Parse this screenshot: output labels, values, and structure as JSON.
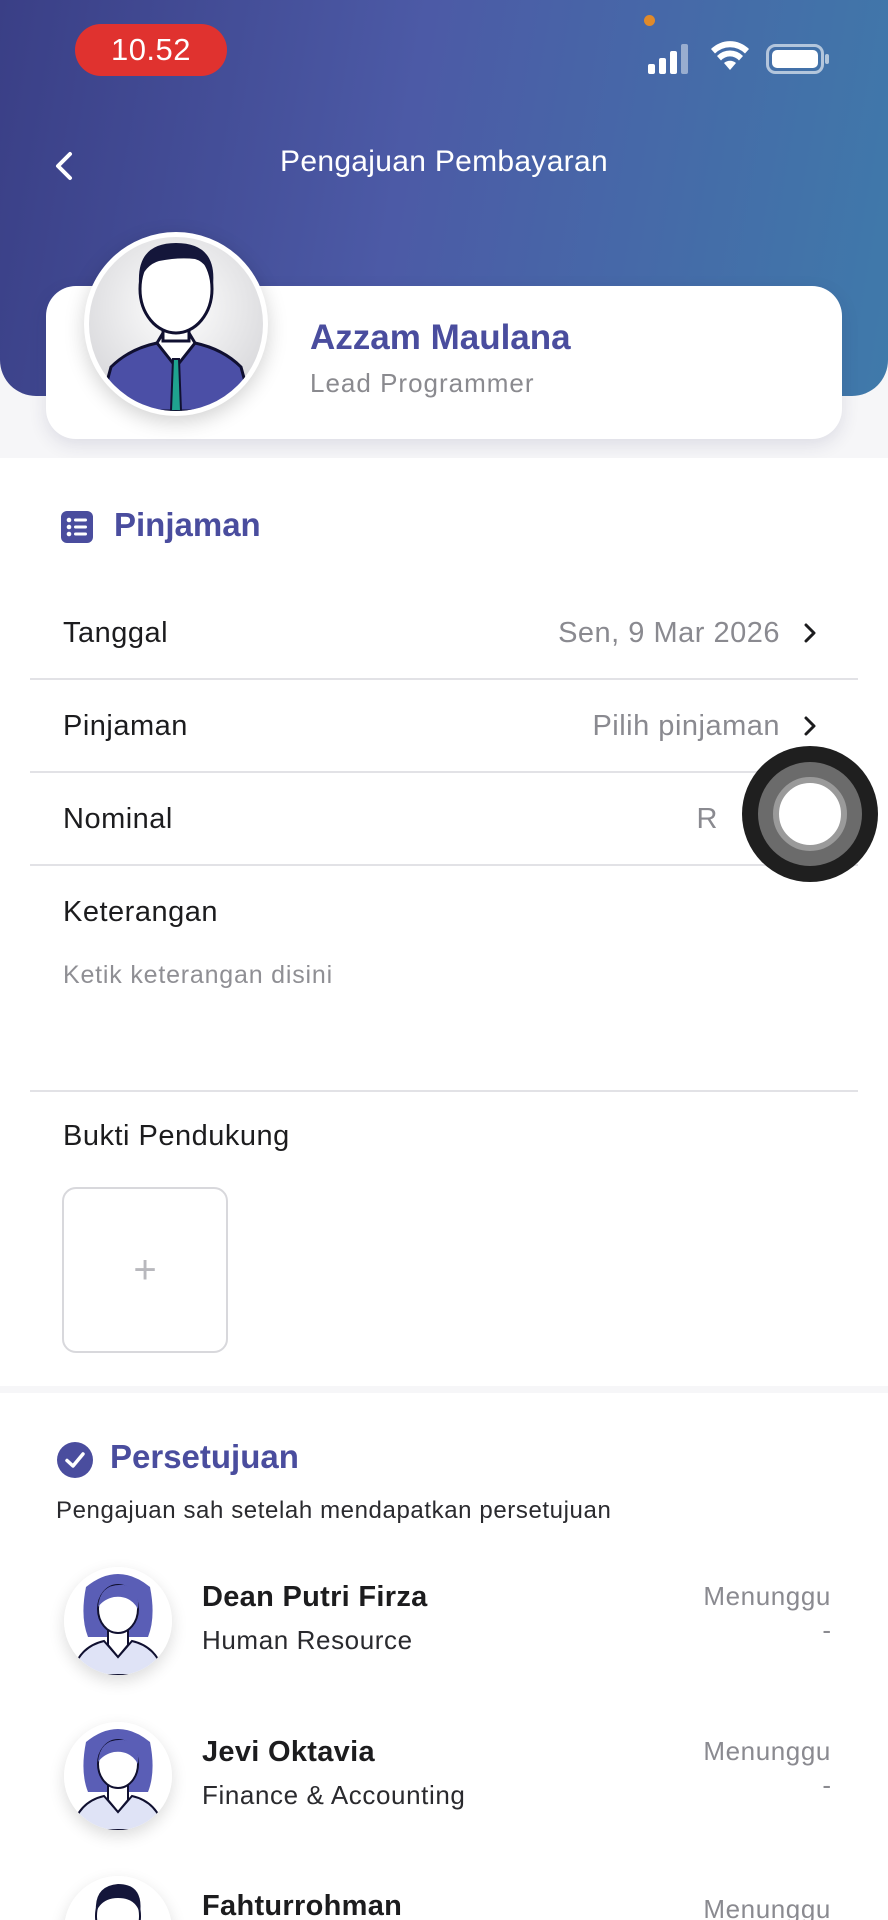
{
  "status_bar": {
    "time": "10.52"
  },
  "header": {
    "title": "Pengajuan Pembayaran"
  },
  "profile": {
    "name": "Azzam Maulana",
    "role": "Lead Programmer"
  },
  "form": {
    "section_title": "Pinjaman",
    "rows": [
      {
        "label": "Tanggal",
        "value": "Sen, 9 Mar 2026"
      },
      {
        "label": "Pinjaman",
        "value": "Pilih pinjaman"
      },
      {
        "label": "Nominal",
        "value": "R"
      }
    ],
    "keterangan_label": "Keterangan",
    "keterangan_placeholder": "Ketik keterangan disini",
    "bukti_label": "Bukti Pendukung",
    "bukti_add_symbol": "+"
  },
  "approval": {
    "title": "Persetujuan",
    "description": "Pengajuan sah setelah mendapatkan persetujuan",
    "approvers": [
      {
        "name": "Dean Putri Firza",
        "role": "Human Resource",
        "status": "Menunggu",
        "date": "-"
      },
      {
        "name": "Jevi Oktavia",
        "role": "Finance & Accounting",
        "status": "Menunggu",
        "date": "-"
      },
      {
        "name": "Fahturrohman",
        "role": "",
        "status": "Menunggu",
        "date": ""
      }
    ]
  },
  "colors": {
    "accent": "#4a4d9e",
    "header_start": "#3a3f86",
    "header_end": "#3f7aaa",
    "time_badge": "#e0322f"
  }
}
